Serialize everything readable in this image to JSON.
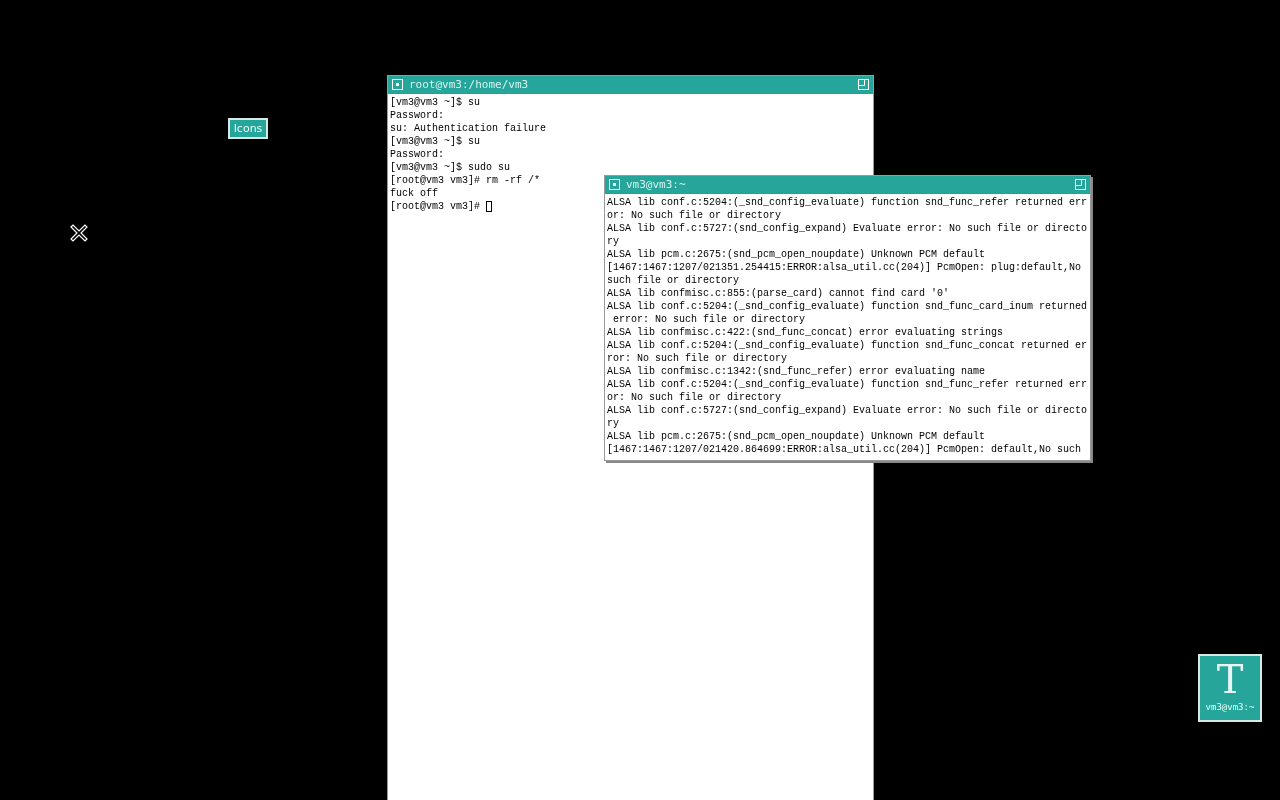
{
  "desktop": {
    "icons_label": "Icons"
  },
  "windows": [
    {
      "title": "root@vm3:/home/vm3",
      "cursor": true,
      "lines": [
        "[vm3@vm3 ~]$ su",
        "Password:",
        "su: Authentication failure",
        "[vm3@vm3 ~]$ su",
        "Password:",
        "[vm3@vm3 ~]$ sudo su",
        "[root@vm3 vm3]# rm -rf /*",
        "fuck off",
        "[root@vm3 vm3]# "
      ]
    },
    {
      "title": "vm3@vm3:~",
      "cursor": false,
      "lines": [
        "ALSA lib conf.c:5204:(_snd_config_evaluate) function snd_func_refer returned err",
        "or: No such file or directory",
        "ALSA lib conf.c:5727:(snd_config_expand) Evaluate error: No such file or directo",
        "ry",
        "ALSA lib pcm.c:2675:(snd_pcm_open_noupdate) Unknown PCM default",
        "[1467:1467:1207/021351.254415:ERROR:alsa_util.cc(204)] PcmOpen: plug:default,No",
        "such file or directory",
        "ALSA lib confmisc.c:855:(parse_card) cannot find card '0'",
        "ALSA lib conf.c:5204:(_snd_config_evaluate) function snd_func_card_inum returned",
        " error: No such file or directory",
        "ALSA lib confmisc.c:422:(snd_func_concat) error evaluating strings",
        "ALSA lib conf.c:5204:(_snd_config_evaluate) function snd_func_concat returned er",
        "ror: No such file or directory",
        "ALSA lib confmisc.c:1342:(snd_func_refer) error evaluating name",
        "ALSA lib conf.c:5204:(_snd_config_evaluate) function snd_func_refer returned err",
        "or: No such file or directory",
        "ALSA lib conf.c:5727:(snd_config_expand) Evaluate error: No such file or directo",
        "ry",
        "ALSA lib pcm.c:2675:(snd_pcm_open_noupdate) Unknown PCM default",
        "[1467:1467:1207/021420.864699:ERROR:alsa_util.cc(204)] PcmOpen: default,No such"
      ]
    }
  ],
  "iconified": [
    {
      "glyph": "T",
      "label": "vm3@vm3:~"
    }
  ]
}
